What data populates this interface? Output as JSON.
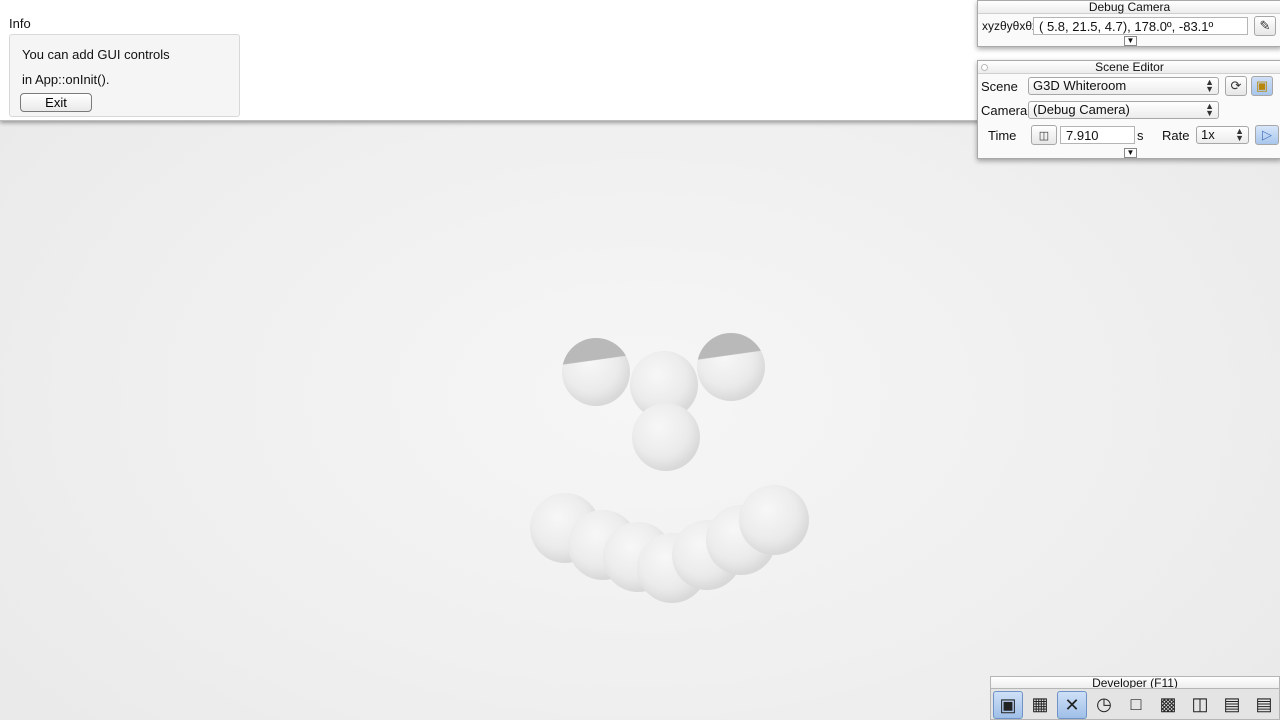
{
  "info": {
    "title": "Info",
    "line1": "You can add GUI controls",
    "line2": "in App::onInit().",
    "exit_label": "Exit"
  },
  "debug_camera": {
    "title": "Debug Camera",
    "coord_label": "xyzθyθxθz",
    "coord_value": "(  5.8,  21.5,   4.7),  178.0º, -83.1º"
  },
  "scene_editor": {
    "title": "Scene Editor",
    "scene_label": "Scene",
    "scene_value": "G3D Whiteroom",
    "camera_label": "Camera",
    "camera_value": "(Debug Camera)",
    "time_label": "Time",
    "time_value": "7.910",
    "time_unit": "s",
    "rate_label": "Rate",
    "rate_value": "1x"
  },
  "developer": {
    "title": "Developer (F11)",
    "tools": [
      "camera-icon",
      "clapperboard-icon",
      "tools-icon",
      "profiler-icon",
      "new-window-icon",
      "console-icon",
      "scene-graph-icon",
      "stats-icon",
      "document-icon"
    ]
  }
}
